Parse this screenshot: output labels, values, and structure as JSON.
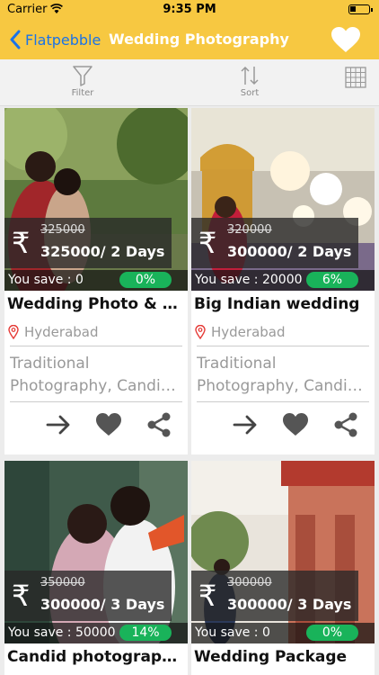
{
  "status": {
    "carrier": "Carrier",
    "time": "9:35 PM"
  },
  "nav": {
    "back_label": "Flatpebble",
    "title": "Wedding Photography"
  },
  "toolbar": {
    "filter_label": "Filter",
    "sort_label": "Sort"
  },
  "colors": {
    "accent": "#f7c841",
    "link": "#1a73e8",
    "discount": "#19b35a"
  },
  "currency_symbol": "₹",
  "listings": [
    {
      "old_price": "325000",
      "price": "325000/ 2 Days",
      "you_save": "You save : 0",
      "discount": "0%",
      "name": "Wedding Photo & Vid...",
      "location": "Hyderabad",
      "tags_line1": "Traditional",
      "tags_line2": "Photography, Candid..."
    },
    {
      "old_price": "320000",
      "price": "300000/ 2 Days",
      "you_save": "You save : 20000",
      "discount": "6%",
      "name": "Big Indian wedding",
      "location": "Hyderabad",
      "tags_line1": "Traditional",
      "tags_line2": "Photography, Candid..."
    },
    {
      "old_price": "350000",
      "price": "300000/ 3 Days",
      "you_save": "You save : 50000",
      "discount": "14%",
      "name": "Candid photography..."
    },
    {
      "old_price": "300000",
      "price": "300000/ 3 Days",
      "you_save": "You save : 0",
      "discount": "0%",
      "name": "Wedding Package"
    }
  ]
}
